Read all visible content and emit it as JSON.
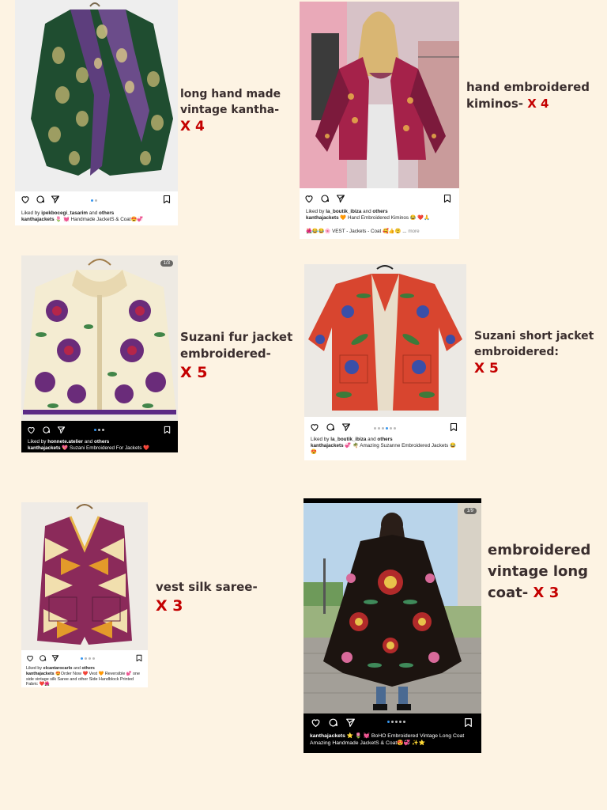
{
  "posts": [
    {
      "liked_user": "ipekbocegi_tasarim",
      "liked_prefix": "Liked by",
      "liked_mid": "and",
      "liked_others": "others",
      "handle": "kanthajackets",
      "caption": "🌷 💓 Handmade JacketS & Coat😍💞"
    },
    {
      "liked_user": "la_boutik_ibiza",
      "liked_prefix": "Liked by",
      "liked_mid": "and",
      "liked_others": "others",
      "handle": "kanthajackets",
      "caption": "🧡 Hand Embroidered Kiminos 😂 ❤️🙏",
      "caption2": "🌺😂😂🌸 VEST - Jackets - Coat 🥰👍😲 ...",
      "more": "more"
    },
    {
      "counter": "1/3",
      "liked_user": "honnete.atelier",
      "liked_prefix": "Liked by",
      "liked_mid": "and",
      "liked_others": "others",
      "handle": "kanthajackets",
      "caption": "💖 Suzani Embroidered For Jackets ❤️"
    },
    {
      "liked_user": "la_boutik_ibiza",
      "liked_prefix": "Liked by",
      "liked_mid": "and",
      "liked_others": "others",
      "handle": "kanthajackets",
      "caption": "💞 🌴 Amazing Suzanne Embroidered Jackets 😂😍"
    },
    {
      "liked_user": "elcantarocarlo",
      "liked_prefix": "Liked by",
      "liked_mid": "and",
      "liked_others": "others",
      "handle": "kanthajackets",
      "caption": "😍Order Now ❤️ Vest 🧡 Reversible 💕 one side vintage silk Saree and other Side Handblock Printed Fabric ❤️🌺"
    },
    {
      "counter": "1/9",
      "handle": "kanthajackets",
      "caption": "⭐ 🌷 💓 BoHO Embroidered Vintage Long Coat Amazing Handmade JacketS & Coat😍💞 ✨⭐"
    }
  ],
  "labels": [
    {
      "lines": [
        "long hand made",
        "vintage kantha-"
      ],
      "qty": "X 4"
    },
    {
      "lines": [
        "hand embroidered",
        "kiminos-"
      ],
      "qty": "X 4"
    },
    {
      "lines": [
        "Suzani fur jacket",
        "embroidered-"
      ],
      "qty": "X 5"
    },
    {
      "lines": [
        "Suzani short jacket",
        "embroidered:"
      ],
      "qty": "X 5"
    },
    {
      "lines": [
        "vest silk saree-"
      ],
      "qty": "X 3"
    },
    {
      "lines": [
        "embroidered",
        "vintage long"
      ],
      "line3": "coat-",
      "qty": "X 3"
    }
  ],
  "icons": [
    "heart-icon",
    "comment-icon",
    "share-icon",
    "bookmark-icon"
  ],
  "colors": {
    "background": "#fdf3e3",
    "label_text": "#3a2e2e",
    "quantity": "#c40000",
    "carousel_active": "#3897f0"
  }
}
